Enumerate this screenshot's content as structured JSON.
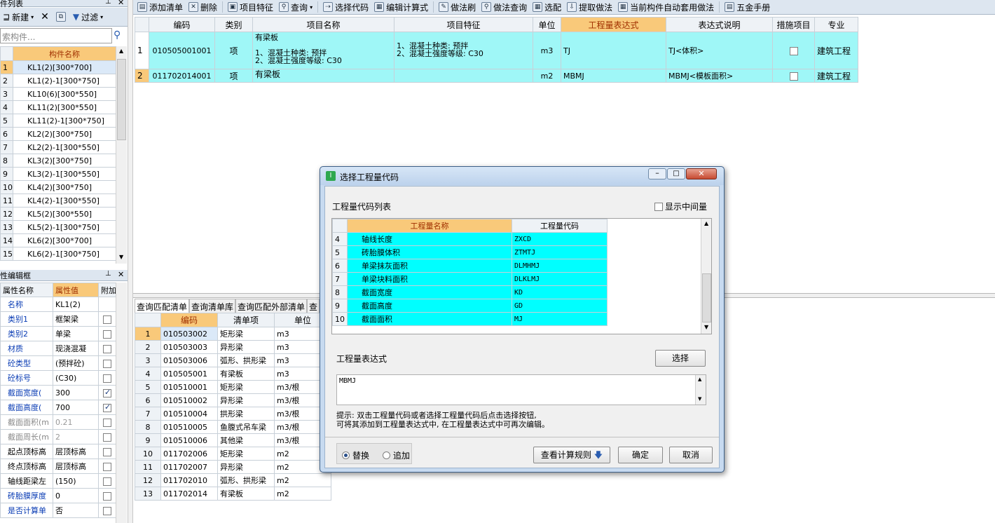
{
  "component_panel": {
    "title": "件列表",
    "new_label": "新建",
    "filter_label": "过滤",
    "search_placeholder": "索构件...",
    "header": "构件名称",
    "rows": [
      {
        "n": "1",
        "name": "KL1(2)[300*700]"
      },
      {
        "n": "2",
        "name": "KL1(2)-1[300*750]"
      },
      {
        "n": "3",
        "name": "KL10(6)[300*550]"
      },
      {
        "n": "4",
        "name": "KL11(2)[300*550]"
      },
      {
        "n": "5",
        "name": "KL11(2)-1[300*750]"
      },
      {
        "n": "6",
        "name": "KL2(2)[300*750]"
      },
      {
        "n": "7",
        "name": "KL2(2)-1[300*550]"
      },
      {
        "n": "8",
        "name": "KL3(2)[300*750]"
      },
      {
        "n": "9",
        "name": "KL3(2)-1[300*550]"
      },
      {
        "n": "10",
        "name": "KL4(2)[300*750]"
      },
      {
        "n": "11",
        "name": "KL4(2)-1[300*550]"
      },
      {
        "n": "12",
        "name": "KL5(2)[300*550]"
      },
      {
        "n": "13",
        "name": "KL5(2)-1[300*750]"
      },
      {
        "n": "14",
        "name": "KL6(2)[300*700]"
      },
      {
        "n": "15",
        "name": "KL6(2)-1[300*750]"
      }
    ]
  },
  "property_panel": {
    "title": "性编辑框",
    "col_name": "属性名称",
    "col_value": "属性值",
    "col_extra": "附加",
    "rows": [
      {
        "name": "名称",
        "value": "KL1(2)",
        "blue": true,
        "chk": null
      },
      {
        "name": "类别1",
        "value": "框架梁",
        "blue": true,
        "chk": false
      },
      {
        "name": "类别2",
        "value": "单梁",
        "blue": true,
        "chk": false
      },
      {
        "name": "材质",
        "value": "现浇混凝",
        "blue": true,
        "chk": false
      },
      {
        "name": "砼类型",
        "value": "(预拌砼)",
        "blue": true,
        "chk": false
      },
      {
        "name": "砼标号",
        "value": "(C30)",
        "blue": true,
        "chk": false
      },
      {
        "name": "截面宽度(",
        "value": "300",
        "blue": true,
        "chk": true
      },
      {
        "name": "截面高度(",
        "value": "700",
        "blue": true,
        "chk": true
      },
      {
        "name": "截面面积(m",
        "value": "0.21",
        "blue": false,
        "gray": true,
        "chk": false
      },
      {
        "name": "截面周长(m",
        "value": "2",
        "blue": false,
        "gray": true,
        "chk": false
      },
      {
        "name": "起点顶标高",
        "value": "层顶标高",
        "blue": false,
        "chk": false
      },
      {
        "name": "终点顶标高",
        "value": "层顶标高",
        "blue": false,
        "chk": false
      },
      {
        "name": "轴线距梁左",
        "value": "(150)",
        "blue": false,
        "chk": false
      },
      {
        "name": "砖胎膜厚度",
        "value": "0",
        "blue": true,
        "chk": false
      },
      {
        "name": "是否计算单",
        "value": "否",
        "blue": true,
        "chk": false
      }
    ]
  },
  "toolbar": {
    "items": [
      "添加清单",
      "删除",
      "项目特征",
      "查询",
      "选择代码",
      "编辑计算式",
      "做法刷",
      "做法查询",
      "选配",
      "提取做法",
      "当前构件自动套用做法",
      "五金手册"
    ]
  },
  "main_table": {
    "headers": [
      "编码",
      "类别",
      "项目名称",
      "项目特征",
      "单位",
      "工程量表达式",
      "表达式说明",
      "措施项目",
      "专业"
    ],
    "rows": [
      {
        "n": "1",
        "code": "010505001001",
        "type": "项",
        "name_lines": [
          "有梁板",
          "",
          "1、混凝土种类: 预拌",
          "2、混凝土强度等级: C30"
        ],
        "feature_lines": [
          "1、混凝土种类: 预拌",
          "2、混凝土强度等级: C30"
        ],
        "unit": "m3",
        "expr": "TJ",
        "desc": "TJ<体积>",
        "spec": "建筑工程"
      },
      {
        "n": "2",
        "code": "011702014001",
        "type": "项",
        "name_lines": [
          "有梁板"
        ],
        "feature_lines": [
          ""
        ],
        "unit": "m2",
        "expr": "MBMJ",
        "desc": "MBMJ<模板面积>",
        "spec": "建筑工程"
      }
    ]
  },
  "bottom_tabs": [
    "查询匹配清单",
    "查询清单库",
    "查询匹配外部清单",
    "查"
  ],
  "bottom_table": {
    "headers": [
      "编码",
      "清单项",
      "单位"
    ],
    "rows": [
      {
        "n": "1",
        "code": "010503002",
        "item": "矩形梁",
        "unit": "m3"
      },
      {
        "n": "2",
        "code": "010503003",
        "item": "异形梁",
        "unit": "m3"
      },
      {
        "n": "3",
        "code": "010503006",
        "item": "弧形、拱形梁",
        "unit": "m3"
      },
      {
        "n": "4",
        "code": "010505001",
        "item": "有梁板",
        "unit": "m3"
      },
      {
        "n": "5",
        "code": "010510001",
        "item": "矩形梁",
        "unit": "m3/根"
      },
      {
        "n": "6",
        "code": "010510002",
        "item": "异形梁",
        "unit": "m3/根"
      },
      {
        "n": "7",
        "code": "010510004",
        "item": "拱形梁",
        "unit": "m3/根"
      },
      {
        "n": "8",
        "code": "010510005",
        "item": "鱼腹式吊车梁",
        "unit": "m3/根"
      },
      {
        "n": "9",
        "code": "010510006",
        "item": "其他梁",
        "unit": "m3/根"
      },
      {
        "n": "10",
        "code": "011702006",
        "item": "矩形梁",
        "unit": "m2"
      },
      {
        "n": "11",
        "code": "011702007",
        "item": "异形梁",
        "unit": "m2"
      },
      {
        "n": "12",
        "code": "011702010",
        "item": "弧形、拱形梁",
        "unit": "m2"
      },
      {
        "n": "13",
        "code": "011702014",
        "item": "有梁板",
        "unit": "m2"
      }
    ]
  },
  "dialog": {
    "title": "选择工程量代码",
    "list_label": "工程量代码列表",
    "show_middle": "显示中间量",
    "col_name": "工程量名称",
    "col_code": "工程量代码",
    "rows": [
      {
        "n": "4",
        "name": "轴线长度",
        "code": "ZXCD"
      },
      {
        "n": "5",
        "name": "砖胎膜体积",
        "code": "ZTMTJ"
      },
      {
        "n": "6",
        "name": "单梁抹灰面积",
        "code": "DLMHMJ"
      },
      {
        "n": "7",
        "name": "单梁块料面积",
        "code": "DLKLMJ"
      },
      {
        "n": "8",
        "name": "截面宽度",
        "code": "KD"
      },
      {
        "n": "9",
        "name": "截面高度",
        "code": "GD"
      },
      {
        "n": "10",
        "name": "截面面积",
        "code": "MJ"
      }
    ],
    "expr_label": "工程量表达式",
    "select_button": "选择",
    "expr_value": "MBMJ",
    "hint1": "提示: 双击工程量代码或者选择工程量代码后点击选择按钮,",
    "hint2": "可将其添加到工程量表达式中, 在工程量表达式中可再次编辑。",
    "radio_replace": "替换",
    "radio_append": "追加",
    "rules_button": "查看计算规则",
    "ok_button": "确定",
    "cancel_button": "取消"
  },
  "colors": {
    "header_orange": "#f9c97a",
    "cyan": "#9ff7f7",
    "dialog_cyan": "#00ffff",
    "sel_row": "#dbe9f8"
  }
}
